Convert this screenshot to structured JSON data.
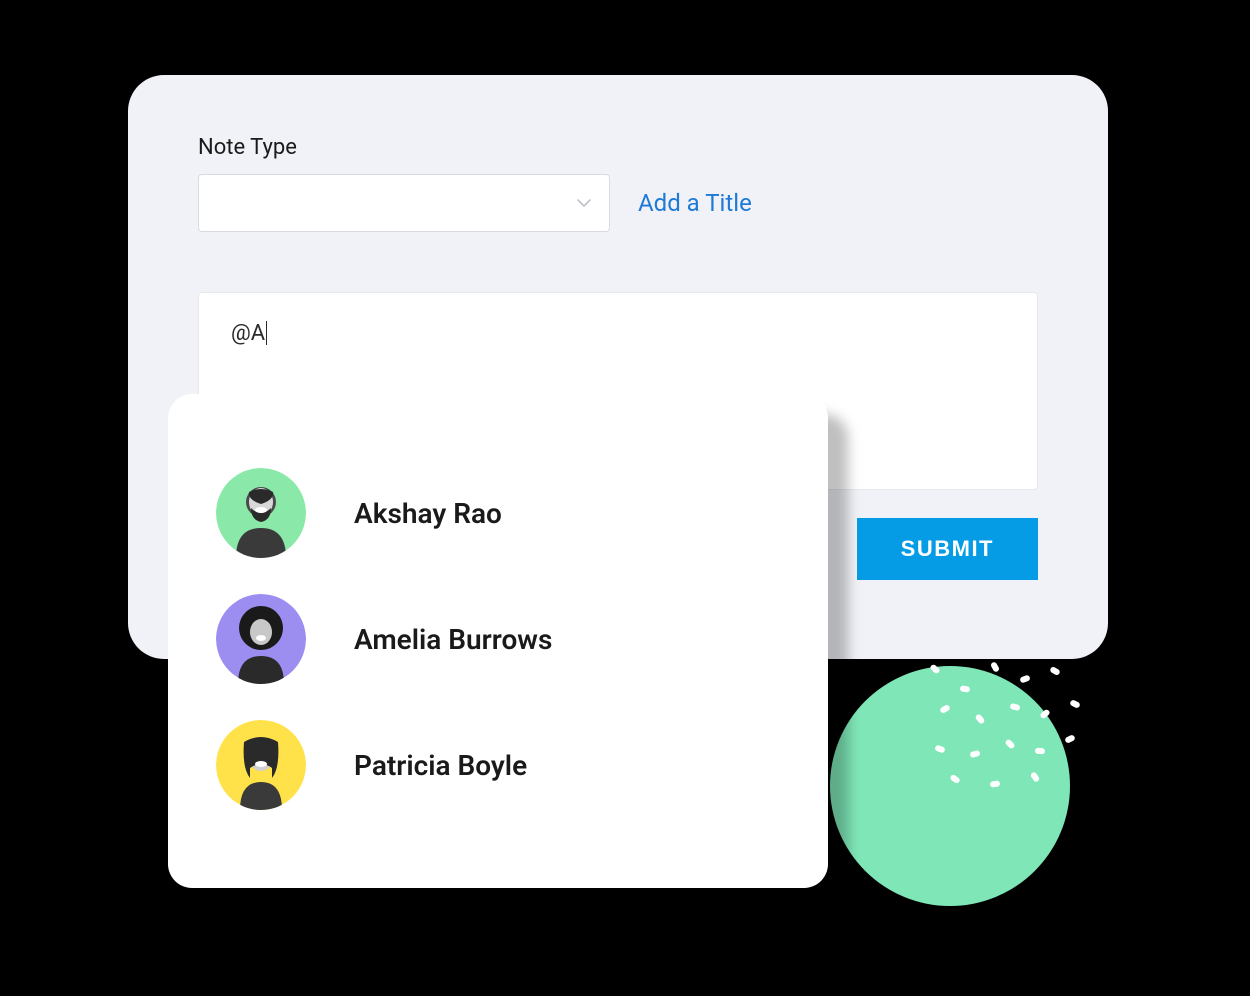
{
  "note": {
    "type_label": "Note Type",
    "add_title_label": "Add a Title",
    "editor_value": "@A",
    "submit_label": "SUBMIT"
  },
  "mentions": [
    {
      "name": "Akshay Rao",
      "avatar_bg": "#8ae9a8"
    },
    {
      "name": "Amelia Burrows",
      "avatar_bg": "#9b8ef0"
    },
    {
      "name": "Patricia Boyle",
      "avatar_bg": "#ffe24a"
    }
  ]
}
